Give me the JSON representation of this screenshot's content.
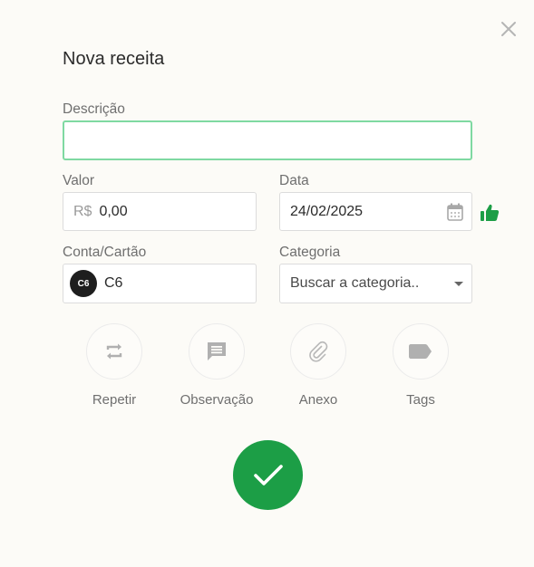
{
  "modal": {
    "title": "Nova receita",
    "close_icon": "close-icon"
  },
  "form": {
    "description": {
      "label": "Descrição",
      "value": "",
      "placeholder": ""
    },
    "value": {
      "label": "Valor",
      "currency": "R$",
      "amount": "0,00"
    },
    "date": {
      "label": "Data",
      "value": "24/02/2025",
      "icon": "calendar-icon",
      "status_icon": "thumbs-up-icon",
      "status_color": "#1c9e46"
    },
    "account": {
      "label": "Conta/Cartão",
      "logo_text": "C6",
      "name": "C6"
    },
    "category": {
      "label": "Categoria",
      "placeholder": "Buscar a categoria.."
    }
  },
  "actions": [
    {
      "label": "Repetir",
      "icon": "repeat-icon"
    },
    {
      "label": "Observação",
      "icon": "comment-icon"
    },
    {
      "label": "Anexo",
      "icon": "paperclip-icon"
    },
    {
      "label": "Tags",
      "icon": "tag-icon"
    }
  ],
  "confirm": {
    "icon": "check-icon",
    "color": "#1c9e46"
  }
}
